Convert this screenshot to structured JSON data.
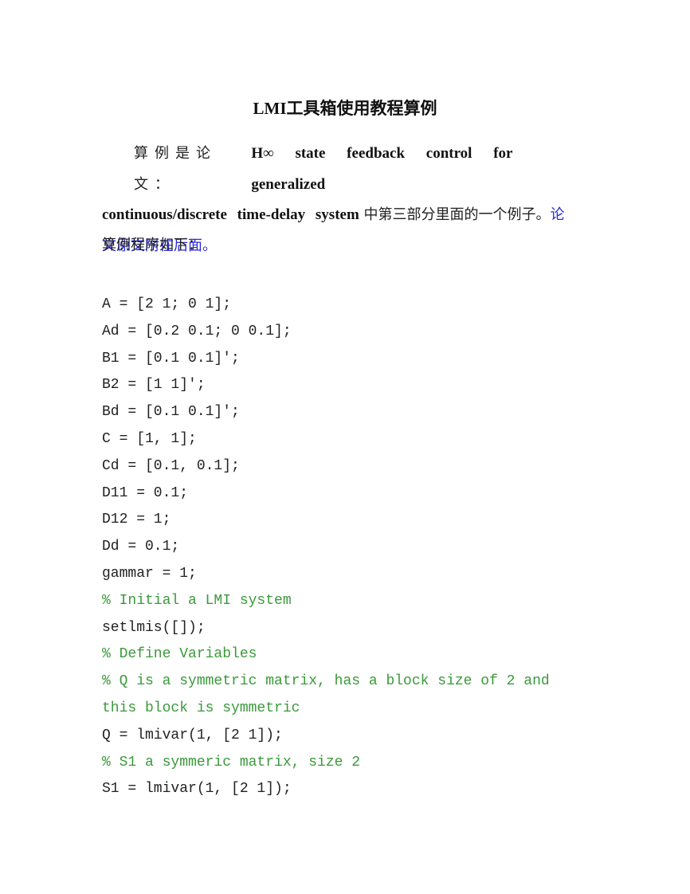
{
  "title": "LMI工具箱使用教程算例",
  "intro": {
    "prefix": "算例是论文：",
    "paper_title_line1": "H∞ state feedback control for generalized",
    "paper_title_line2": "continuous/discrete time-delay system",
    "middle": "中第三部分里面的一个例子。",
    "link_text_1": "论",
    "link_text_2": "文原文附在后面。"
  },
  "program_label": "算例程序如下：",
  "code_lines": [
    {
      "text": "A = [2 1; 0 1];",
      "type": "code"
    },
    {
      "text": "Ad = [0.2 0.1; 0 0.1];",
      "type": "code"
    },
    {
      "text": "B1 = [0.1 0.1]';",
      "type": "code"
    },
    {
      "text": "B2 = [1 1]';",
      "type": "code"
    },
    {
      "text": "Bd = [0.1 0.1]';",
      "type": "code"
    },
    {
      "text": "C = [1, 1];",
      "type": "code"
    },
    {
      "text": "Cd = [0.1, 0.1];",
      "type": "code"
    },
    {
      "text": "D11 = 0.1;",
      "type": "code"
    },
    {
      "text": "D12 = 1;",
      "type": "code"
    },
    {
      "text": "Dd = 0.1;",
      "type": "code"
    },
    {
      "text": "gammar = 1;",
      "type": "code"
    },
    {
      "text": "% Initial a LMI system",
      "type": "comment"
    },
    {
      "text": "setlmis([]);",
      "type": "code"
    },
    {
      "text": "% Define Variables",
      "type": "comment"
    },
    {
      "text": "% Q is a symmetric matrix, has a block size of 2 and",
      "type": "comment"
    },
    {
      "text": "this block is symmetric",
      "type": "comment"
    },
    {
      "text": "Q = lmivar(1, [2 1]);",
      "type": "code"
    },
    {
      "text": "% S1 a symmeric matrix, size 2",
      "type": "comment"
    },
    {
      "text": "S1 = lmivar(1, [2 1]);",
      "type": "code"
    }
  ],
  "colors": {
    "comment": "#3a9a3a",
    "link": "#2b2bd8",
    "text": "#222222"
  }
}
